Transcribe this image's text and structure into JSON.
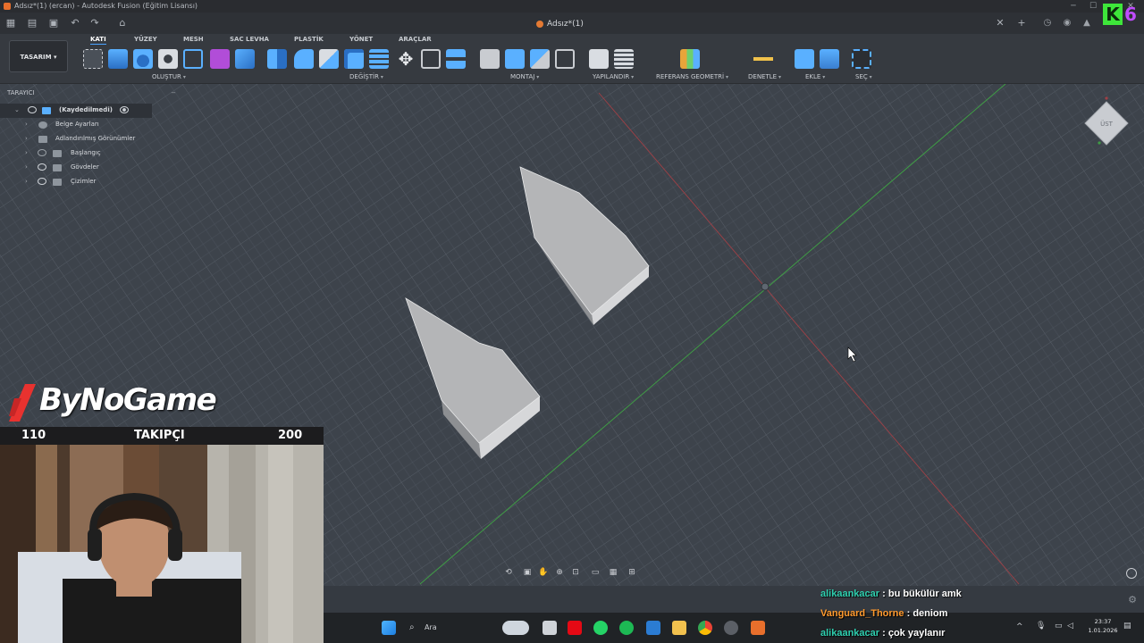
{
  "window": {
    "title": "Adsız*(1) (ercan) - Autodesk Fusion (Eğitim Lisansı)"
  },
  "tab": {
    "name": "Adsız*(1)"
  },
  "overlay_badge": {
    "letter": "K",
    "number": "6"
  },
  "toolbar": {
    "workspace": "TASARIM",
    "env_tabs": [
      "KATI",
      "YÜZEY",
      "MESH",
      "SAC LEVHA",
      "PLASTİK",
      "YÖNET",
      "ARAÇLAR"
    ],
    "active_tab": "KATI",
    "groups": [
      "OLUŞTUR",
      "DEĞİŞTİR",
      "MONTAJ",
      "YAPILANDIR",
      "REFERANS GEOMETRİ",
      "DENETLE",
      "EKLE",
      "SEÇ"
    ]
  },
  "browser": {
    "title": "TARAYICI",
    "root": "(Kaydedilmedi)",
    "items": [
      "Belge Ayarları",
      "Adlandırılmış Görünümler",
      "Başlangıç",
      "Gövdeler",
      "Çizimler"
    ]
  },
  "viewcube": {
    "label": "ÜST"
  },
  "stream": {
    "brand": "ByNoGame",
    "follow_min": "110",
    "follow_label": "TAKIPÇI",
    "follow_max": "200",
    "follow_progress": 0
  },
  "chat": [
    {
      "user": "alikaankacar",
      "user_color": "#2fd0b0",
      "sep": " : ",
      "message": "bu bükülür amk"
    },
    {
      "user": "Vanguard_Thorne",
      "user_color": "#ff9a2e",
      "sep": " : ",
      "message": "deniom"
    },
    {
      "user": "alikaankacar",
      "user_color": "#2fd0b0",
      "sep": " : ",
      "message": "çok yaylanır"
    }
  ],
  "taskbar": {
    "search_placeholder": "Ara",
    "time": "23:37",
    "date": "1.01.2026"
  },
  "colors": {
    "accent": "#4aa3ff",
    "viewport_bg": "#3d434b",
    "grid": "#58606a",
    "axis_x": "#a04046",
    "axis_y": "#3f9c45",
    "body_fill": "#b4b5b7"
  }
}
